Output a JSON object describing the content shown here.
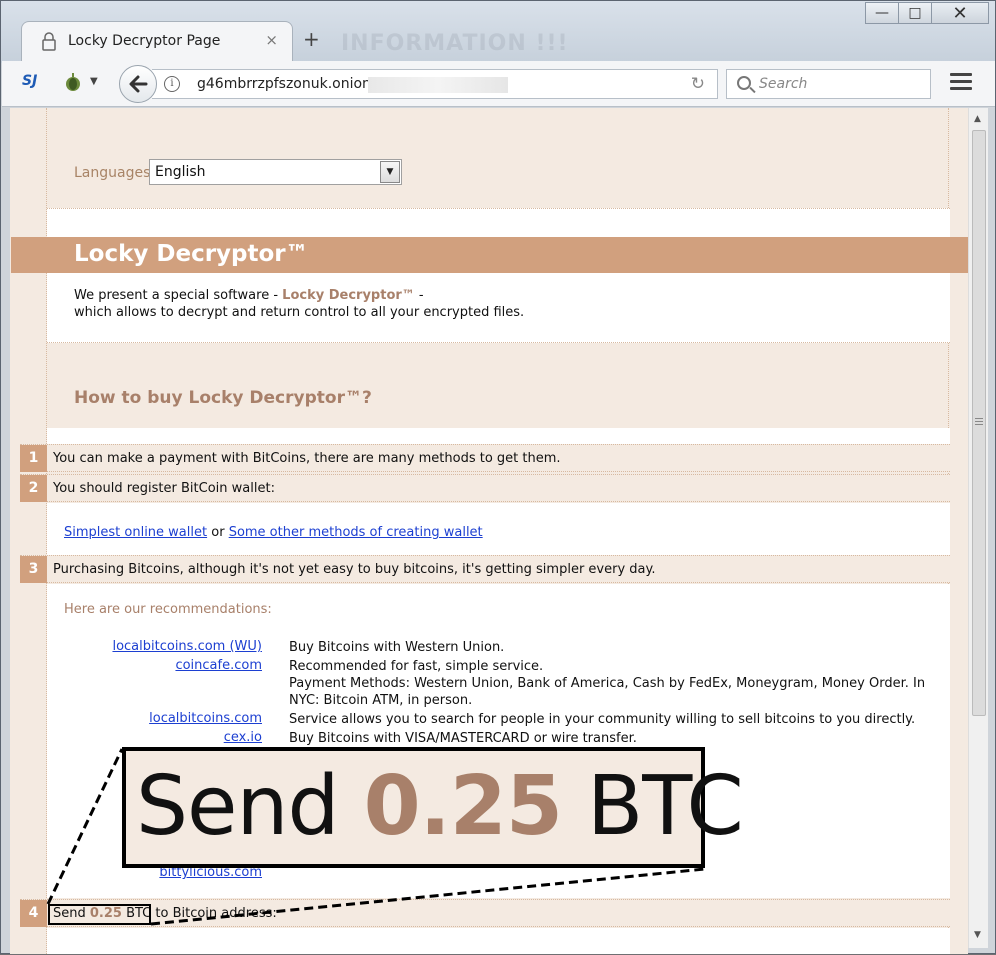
{
  "window": {
    "watermark": "INFORMATION !!!",
    "controls": {
      "minimize": "—",
      "maximize": "□",
      "close": "✕"
    }
  },
  "tab": {
    "title": "Locky Decryptor Page",
    "close": "×",
    "new_tab": "+"
  },
  "navbar": {
    "ext1": "SJ",
    "url": "g46mbrrzpfszonuk.onion/",
    "search_placeholder": "Search"
  },
  "page": {
    "languages_label": "Languages:",
    "language_selected": "English",
    "title": "Locky Decryptor™",
    "intro_line1_pre": "We present a special software - ",
    "intro_product": "Locky Decryptor™",
    "intro_line1_post": " -",
    "intro_line2": "which allows to decrypt and return control to all your encrypted files.",
    "howto_heading": "How to buy Locky Decryptor™?",
    "steps": [
      {
        "num": "1",
        "text": "You can make a payment with BitCoins, there are many methods to get them."
      },
      {
        "num": "2",
        "text": "You should register BitCoin wallet:"
      },
      {
        "num": "3",
        "text": "Purchasing Bitcoins, although it's not yet easy to buy bitcoins, it's getting simpler every day."
      },
      {
        "num": "4",
        "text_pre": "Send ",
        "amount": "0.25",
        "unit": " BTC",
        "text_post": " to Bitcoin address:"
      }
    ],
    "wallet_link1": "Simplest online wallet",
    "wallet_or": " or ",
    "wallet_link2": "Some other methods of creating wallet",
    "recommendations_label": "Here are our recommendations:",
    "recommendations": [
      {
        "site": "localbitcoins.com (WU)",
        "desc": "Buy Bitcoins with Western Union."
      },
      {
        "site": "coincafe.com",
        "desc": "Recommended for fast, simple service.",
        "desc2": "Payment Methods: Western Union, Bank of America, Cash by FedEx, Moneygram, Money Order. In NYC: Bitcoin ATM, in person."
      },
      {
        "site": "localbitcoins.com",
        "desc": "Service allows you to search for people in your community willing to sell bitcoins to you directly."
      },
      {
        "site": "cex.io",
        "desc": "Buy Bitcoins with VISA/MASTERCARD or wire transfer."
      },
      {
        "site": "bittylicious.com",
        "desc": ""
      }
    ]
  },
  "zoom": {
    "pre": "Send ",
    "amount": "0.25",
    "post": " BTC"
  },
  "colors": {
    "accent": "#d1a07e",
    "accent_text": "#a8806a",
    "page_bg": "#f4eae1",
    "link": "#1c3fd1"
  }
}
